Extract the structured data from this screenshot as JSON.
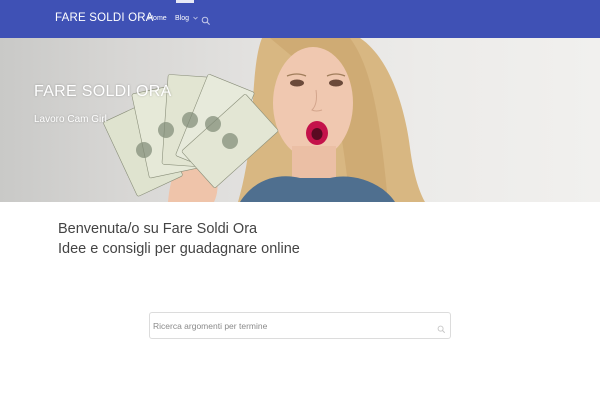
{
  "header": {
    "brand": "FARE SOLDI ORA",
    "nav": [
      {
        "label": "Home"
      },
      {
        "label": "Blog",
        "has_dropdown": true
      }
    ],
    "search_icon": "search-icon",
    "background_color": "#3f51b5"
  },
  "hero": {
    "title": "FARE SOLDI ORA",
    "subtitle": "Lavoro Cam Girl"
  },
  "welcome": {
    "line1": "Benvenuta/o su Fare Soldi Ora",
    "line2": "Idee e consigli per guadagnare online"
  },
  "search": {
    "placeholder": "Ricerca argomenti per termine",
    "value": ""
  }
}
